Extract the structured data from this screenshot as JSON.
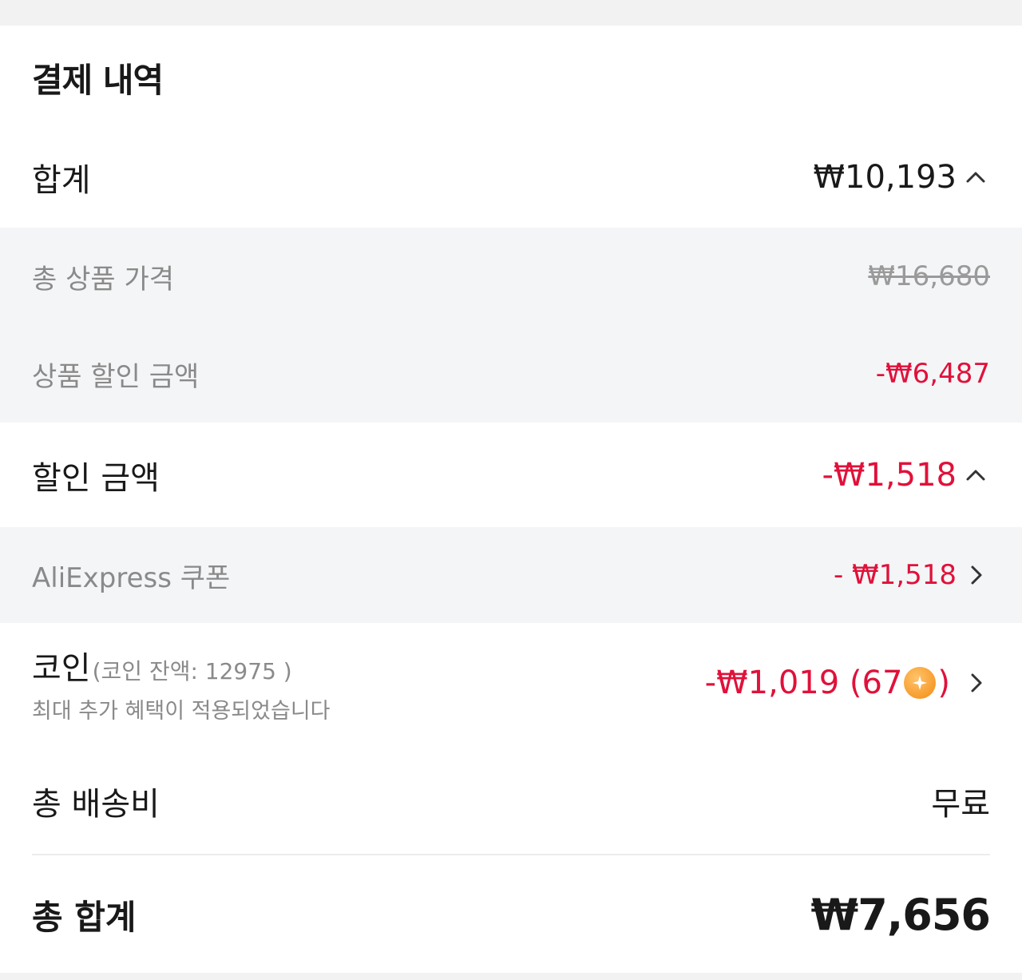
{
  "section_title": "결제 내역",
  "subtotal": {
    "label": "합계",
    "value": "₩10,193"
  },
  "product_total": {
    "label": "총 상품 가격",
    "value": "₩16,680"
  },
  "product_discount": {
    "label": "상품 할인 금액",
    "value": "-₩6,487"
  },
  "discount": {
    "label": "할인 금액",
    "value": "-₩1,518"
  },
  "coupon": {
    "label": "AliExpress 쿠폰",
    "value": "- ₩1,518"
  },
  "coins": {
    "label": "코인",
    "balance": "(코인 잔액: 12975 )",
    "note": "최대 추가 혜택이 적용되었습니다",
    "value": "-₩1,019 (67",
    "value_close": ")"
  },
  "shipping": {
    "label": "총 배송비",
    "value": "무료"
  },
  "grand_total": {
    "label": "총 합계",
    "value": "₩7,656"
  },
  "colors": {
    "accent_red": "#e0113a",
    "coin_orange": "#f48a12",
    "sub_bg": "#f4f5f7"
  },
  "icons": [
    "chevron-up-icon",
    "chevron-right-icon",
    "coin-icon"
  ]
}
